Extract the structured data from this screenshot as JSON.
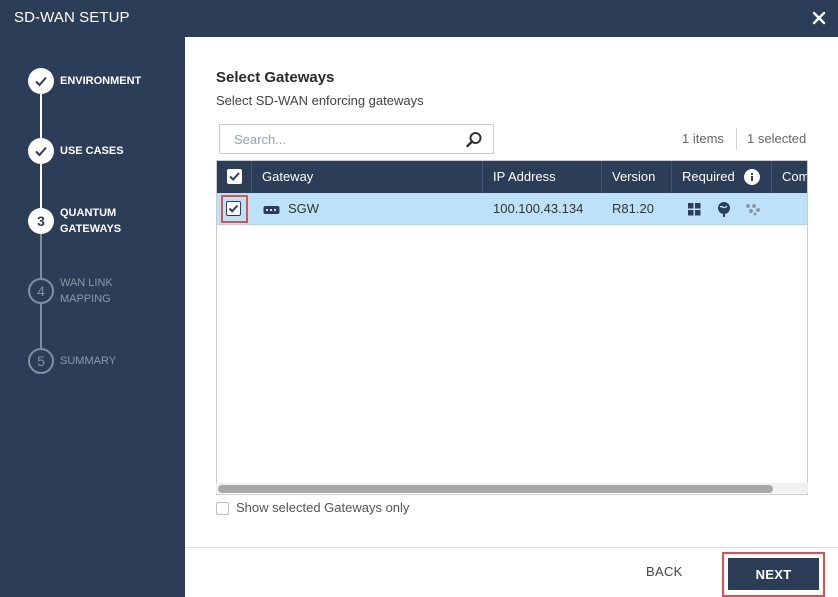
{
  "window": {
    "title": "SD-WAN SETUP",
    "close_icon": "close-icon"
  },
  "sidebar": {
    "steps": [
      {
        "marker": "",
        "label": "ENVIRONMENT",
        "state": "done",
        "icon": "check-icon"
      },
      {
        "marker": "",
        "label": "USE CASES",
        "state": "done",
        "icon": "check-icon"
      },
      {
        "marker": "3",
        "label": "QUANTUM GATEWAYS",
        "state": "active"
      },
      {
        "marker": "4",
        "label": "WAN LINK MAPPING",
        "state": "pending"
      },
      {
        "marker": "5",
        "label": "SUMMARY",
        "state": "pending"
      }
    ]
  },
  "main": {
    "heading": "Select Gateways",
    "subheading": "Select SD-WAN enforcing gateways",
    "search": {
      "placeholder": "Search...",
      "value": "",
      "icon": "search-icon"
    },
    "counts": {
      "items": "1 items",
      "selected": "1 selected"
    },
    "table": {
      "header_checkbox_checked": true,
      "columns": [
        "Gateway",
        "IP Address",
        "Version",
        "Required",
        "Com"
      ],
      "info_icon": "info-icon",
      "rows": [
        {
          "checked": true,
          "gateway": "SGW",
          "gateway_icon": "gateway-device-icon",
          "ip_address": "100.100.43.134",
          "version": "R81.20",
          "required_icons": [
            "blades-grid-icon",
            "globe-pin-icon",
            "cluster-dots-icon"
          ]
        }
      ]
    },
    "show_selected_only": {
      "label": "Show selected Gateways only",
      "checked": false
    }
  },
  "footer": {
    "back_label": "BACK",
    "next_label": "NEXT"
  },
  "colors": {
    "navy": "#2c3e57",
    "row_selected": "#bde1f7",
    "highlight_red": "#e05050",
    "pending_gray": "#7f8ea3"
  }
}
